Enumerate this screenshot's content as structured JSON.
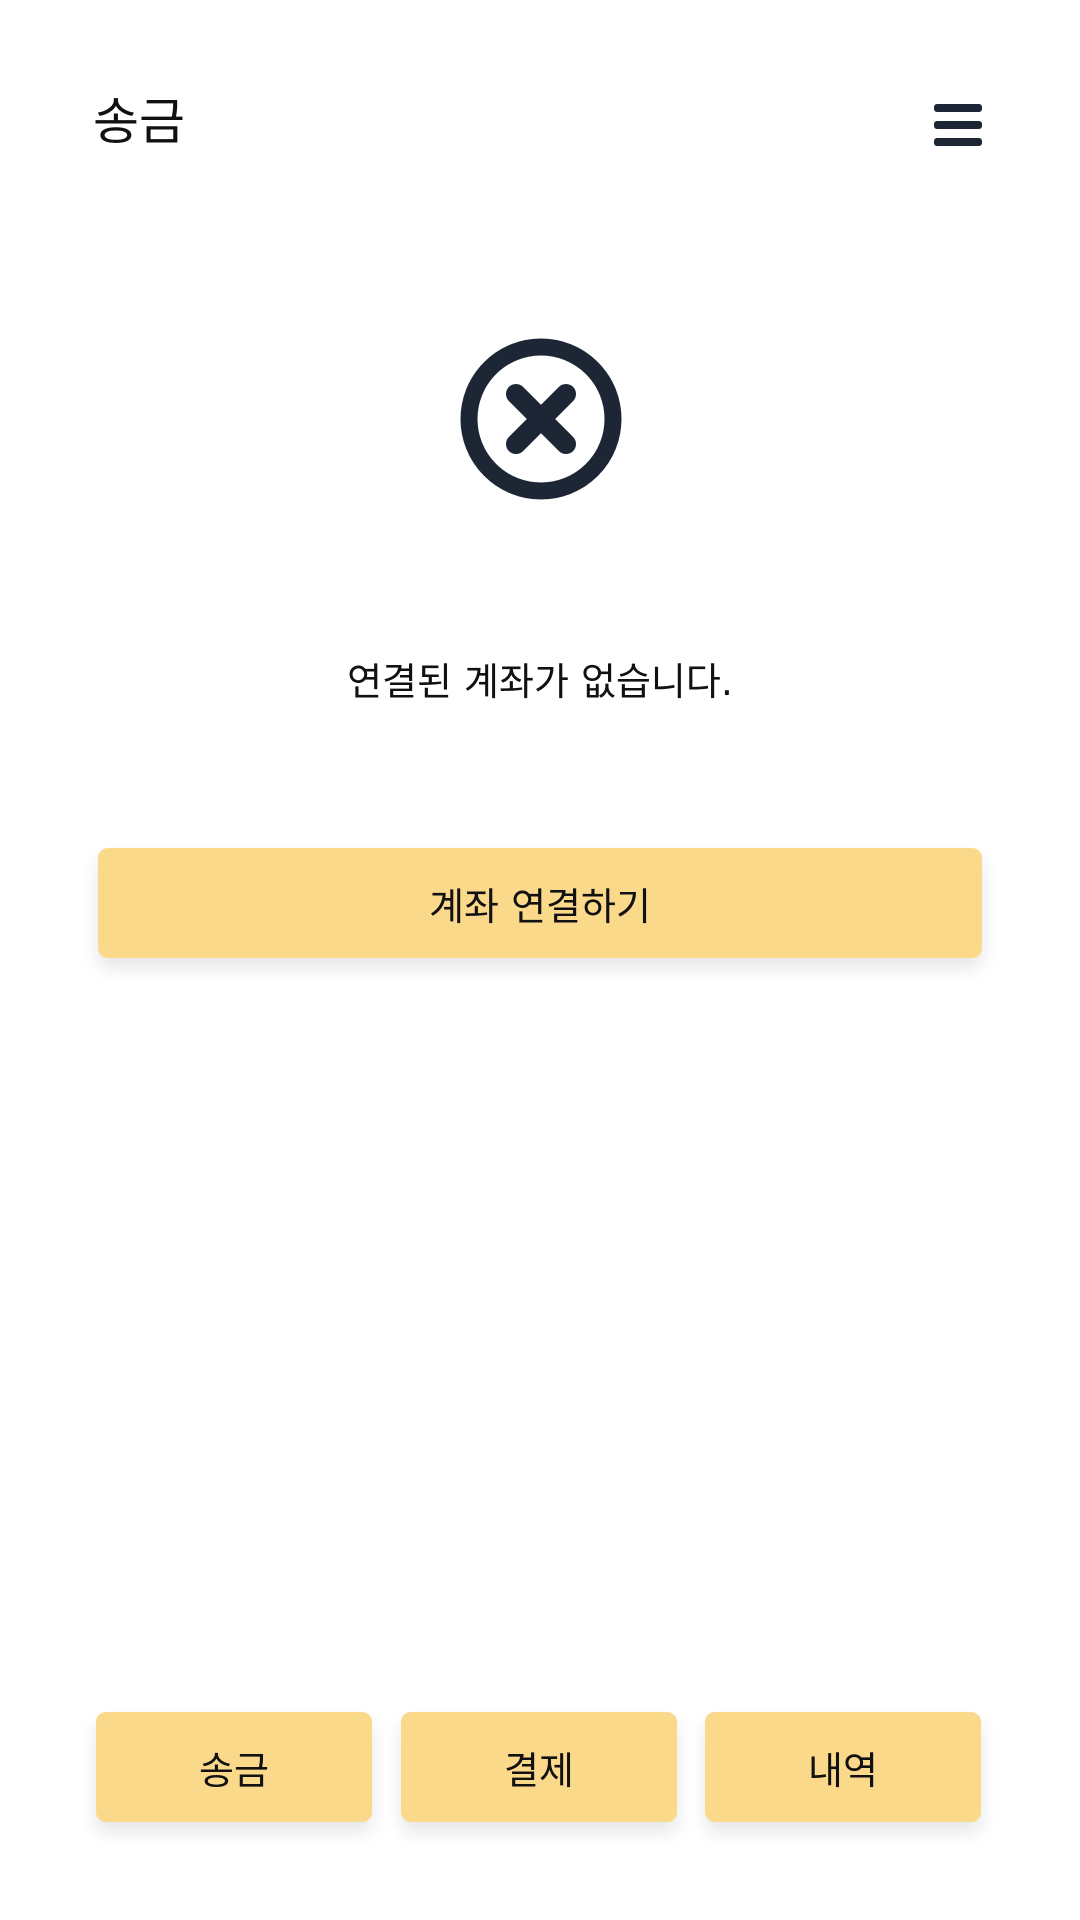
{
  "header": {
    "title": "송금",
    "menu_icon": "hamburger-menu-icon"
  },
  "status": {
    "icon": "close-circle-icon",
    "message": "연결된 계좌가 없습니다."
  },
  "actions": {
    "connect_account_label": "계좌 연결하기"
  },
  "bottom_nav": {
    "items": [
      {
        "label": "송금"
      },
      {
        "label": "결제"
      },
      {
        "label": "내역"
      }
    ]
  },
  "colors": {
    "button_bg": "#fad98a",
    "icon_color": "#1c2635",
    "text": "#111111"
  }
}
